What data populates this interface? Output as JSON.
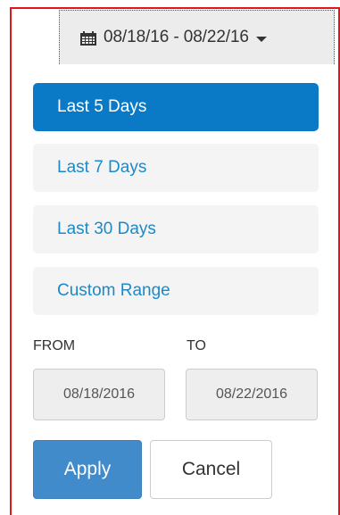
{
  "trigger": {
    "date_range_text": "08/18/16 - 08/22/16",
    "icon": "calendar-icon"
  },
  "ranges": [
    {
      "label": "Last 5 Days",
      "active": true
    },
    {
      "label": "Last 7 Days",
      "active": false
    },
    {
      "label": "Last 30 Days",
      "active": false
    },
    {
      "label": "Custom Range",
      "active": false
    }
  ],
  "from": {
    "label": "FROM",
    "value": "08/18/2016"
  },
  "to": {
    "label": "TO",
    "value": "08/22/2016"
  },
  "buttons": {
    "apply": "Apply",
    "cancel": "Cancel"
  },
  "colors": {
    "accent": "#0b7ac6",
    "apply": "#428bca",
    "link": "#1a8acb",
    "outline": "#e8141b"
  }
}
